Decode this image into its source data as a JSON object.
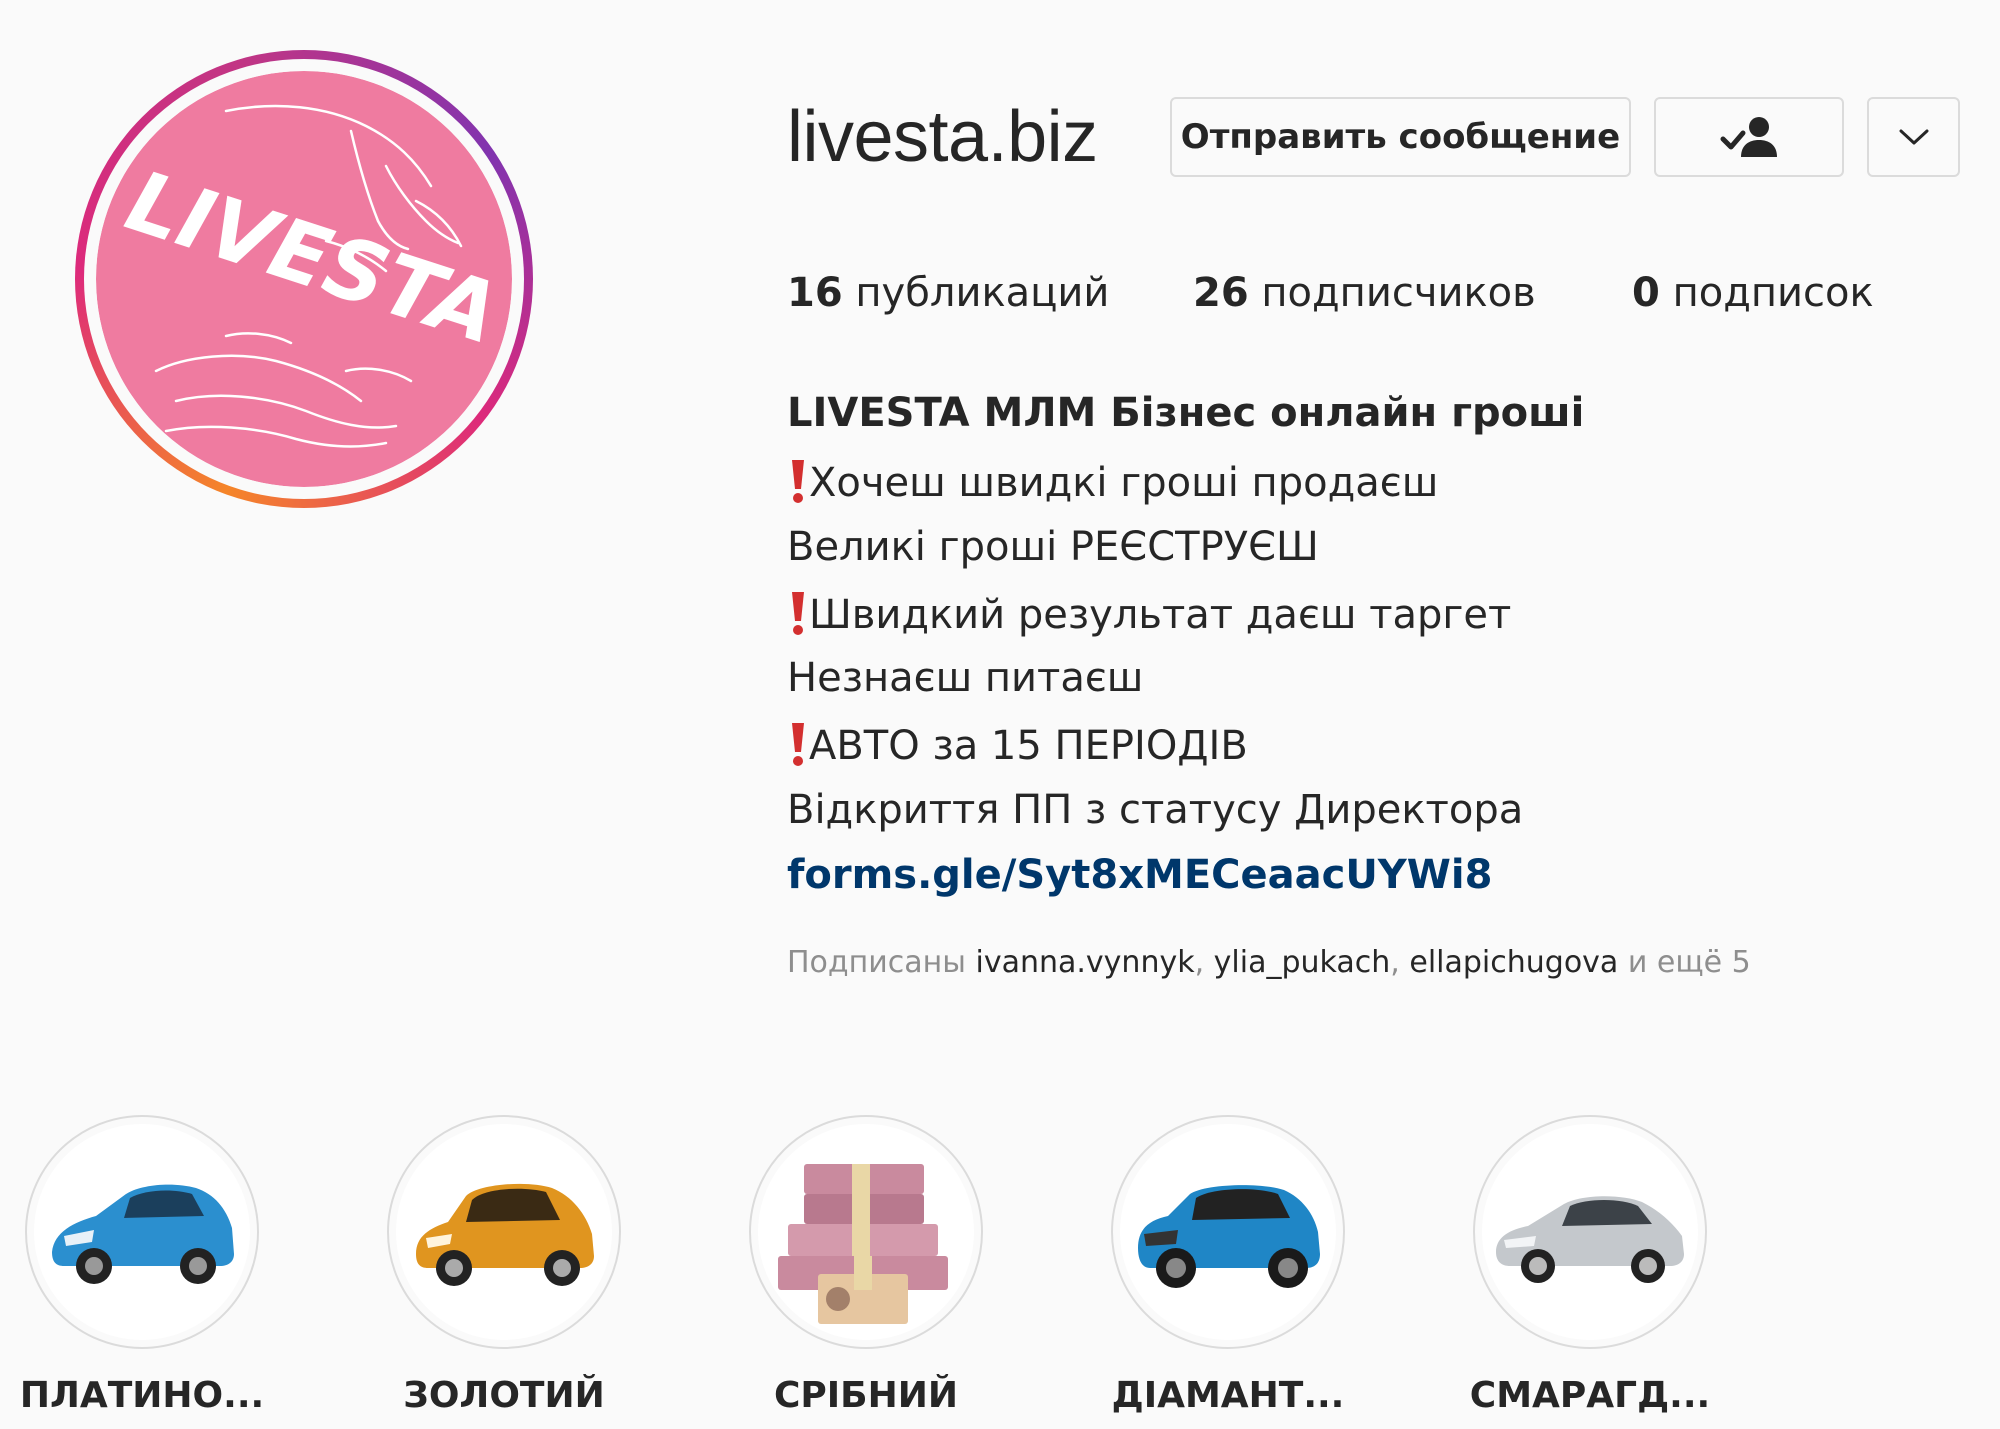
{
  "profile": {
    "username": "livesta.biz",
    "avatar_logo_text": "LIVESTA",
    "brand_color": "#ef7ba0"
  },
  "actions": {
    "message_label": "Отправить сообщение",
    "following_icon": "person-check-icon",
    "more_icon": "chevron-down-icon"
  },
  "stats": [
    {
      "count": "16",
      "label": "публикаций"
    },
    {
      "count": "26",
      "label": "подписчиков"
    },
    {
      "count": "0",
      "label": "подписок"
    }
  ],
  "bio": {
    "name": "LIVESTA МЛМ Бізнес онлайн гроші",
    "lines": [
      {
        "text": "Хочеш швидкі гроші продаєш",
        "exclamation": true
      },
      {
        "text": "Великі гроші РЕЄСТРУЄШ",
        "exclamation": false
      },
      {
        "text": "Швидкий результат даєш таргет",
        "exclamation": true
      },
      {
        "text": "Незнаєш питаєш",
        "exclamation": false
      },
      {
        "text": "АВТО за 15 ПЕРІОДІВ",
        "exclamation": true
      },
      {
        "text": "Відкриття ПП з статусу Директора",
        "exclamation": false
      }
    ],
    "link": "forms.gle/Syt8xMECeaacUYWi8"
  },
  "followed_by": {
    "prefix": "Подписаны",
    "accounts": [
      "ivanna.vynnyk",
      "ylia_pukach",
      "ellapichugova"
    ],
    "suffix": "и ещё 5"
  },
  "highlights": [
    {
      "label": "ПЛАТИНО...",
      "image": "blue-hatchback-car",
      "color": "#2b8fcf"
    },
    {
      "label": "ЗОЛОТИЙ",
      "image": "orange-city-car",
      "color": "#e0951f"
    },
    {
      "label": "СРІБНИЙ",
      "image": "money-stacks",
      "color": "#c98a9e"
    },
    {
      "label": "ДІАМАНТ...",
      "image": "blue-suv-car",
      "color": "#1f86c6"
    },
    {
      "label": "СМАРАГД...",
      "image": "silver-sedan-car",
      "color": "#c4c8cc"
    }
  ]
}
